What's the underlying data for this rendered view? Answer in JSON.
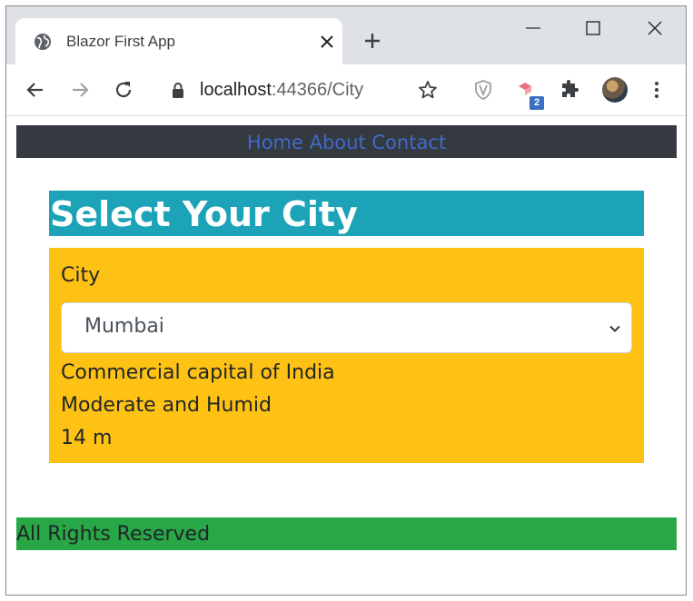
{
  "browser": {
    "tab_title": "Blazor First App",
    "address_host": "localhost",
    "address_path": ":44366/City",
    "extension_badge": "2",
    "icons": [
      "globe-icon",
      "close-icon",
      "plus-icon",
      "minimize-icon",
      "maximize-icon",
      "window-close-icon",
      "back-arrow-icon",
      "forward-arrow-icon",
      "reload-icon",
      "lock-icon",
      "star-icon",
      "shield-extension-icon",
      "extension-icon",
      "puzzle-icon",
      "profile-avatar",
      "kebab-menu-icon"
    ]
  },
  "nav": {
    "home": "Home",
    "about": "About",
    "contact": "Contact",
    "link_color": "#4169c8",
    "background": "#343a40"
  },
  "header": {
    "title": "Select Your City",
    "background": "#1ca3b8"
  },
  "form": {
    "label": "City",
    "selected_city": "Mumbai",
    "description": "Commercial capital of India",
    "climate": "Moderate and Humid",
    "elevation": "14 m",
    "background": "#fec214"
  },
  "footer": {
    "text": "All Rights Reserved",
    "background": "#27a745"
  }
}
